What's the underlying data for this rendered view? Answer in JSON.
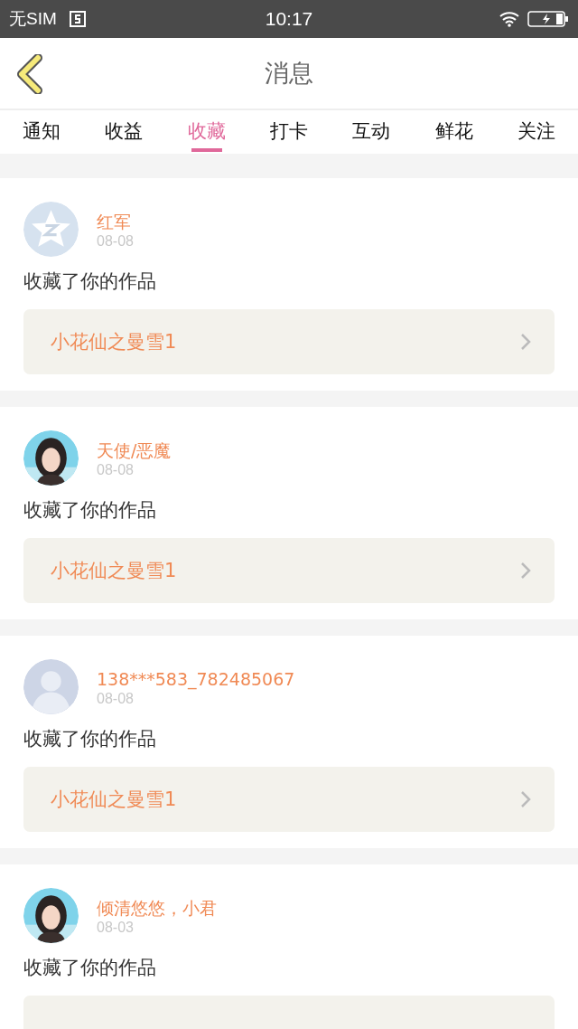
{
  "status_bar": {
    "carrier": "无SIM",
    "time": "10:17"
  },
  "header": {
    "title": "消息"
  },
  "tabs": [
    {
      "label": "通知",
      "selected": false
    },
    {
      "label": "收益",
      "selected": false
    },
    {
      "label": "收藏",
      "selected": true
    },
    {
      "label": "打卡",
      "selected": false
    },
    {
      "label": "互动",
      "selected": false
    },
    {
      "label": "鲜花",
      "selected": false
    },
    {
      "label": "关注",
      "selected": false
    }
  ],
  "messages": [
    {
      "avatar": {
        "kind": "star"
      },
      "name": "红军",
      "date": "08-08",
      "text": "收藏了你的作品",
      "work": "小花仙之曼雪1"
    },
    {
      "name": "天使/恶魔",
      "date": "08-08",
      "text": "收藏了你的作品",
      "work": "小花仙之曼雪1"
    },
    {
      "avatar": {
        "kind": "silhouette"
      },
      "name": "138***583_782485067",
      "date": "08-08",
      "text": "收藏了你的作品",
      "work": "小花仙之曼雪1"
    },
    {
      "name": "倾清悠悠，小君",
      "date": "08-03",
      "text": "收藏了你的作品"
    }
  ]
}
